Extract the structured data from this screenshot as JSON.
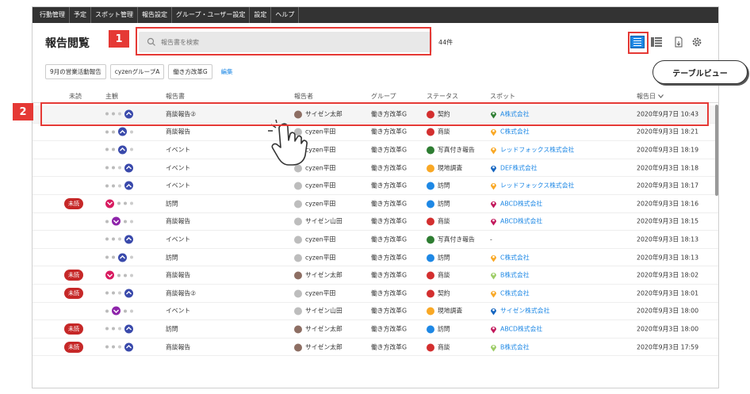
{
  "nav": [
    "行動管理",
    "予定",
    "スポット管理",
    "報告設定",
    "グループ・ユーザー設定",
    "設定",
    "ヘルプ"
  ],
  "header": {
    "title": "報告閲覧",
    "search_placeholder": "報告書を検索",
    "count": "44件"
  },
  "callouts": {
    "one": "1",
    "two": "2",
    "bubble": "テーブルビュー"
  },
  "chips": [
    "9月の営業活動報告",
    "cyzenグループA",
    "働き方改革G"
  ],
  "edit_label": "編集",
  "columns": {
    "unread": "未読",
    "reaction": "主観",
    "report": "報告書",
    "reporter": "報告者",
    "group": "グループ",
    "status": "ステータス",
    "spot": "スポット",
    "date": "報告日"
  },
  "colors": {
    "accent": "#1e88e5",
    "unread": "#c62828",
    "callout": "#e53935"
  },
  "rows": [
    {
      "unread": "",
      "reaction": "blue",
      "report": "商談報告②",
      "reporter": "サイゼン太郎",
      "avatar": "photo",
      "group": "働き方改革G",
      "status": "契約",
      "status_color": "#d32f2f",
      "spot": "A株式会社",
      "spot_icon": "#2e7d32",
      "date": "2020年9月7日 10:43"
    },
    {
      "unread": "",
      "reaction": "blue2",
      "report": "商談報告",
      "reporter": "cyzen平田",
      "avatar": "grey",
      "group": "働き方改革G",
      "status": "商談",
      "status_color": "#d32f2f",
      "spot": "C株式会社",
      "spot_icon": "#f9a825",
      "date": "2020年9月3日 18:21"
    },
    {
      "unread": "",
      "reaction": "blue2",
      "report": "イベント",
      "reporter": "cyzen平田",
      "avatar": "grey",
      "group": "働き方改革G",
      "status": "写真付き報告",
      "status_color": "#2e7d32",
      "spot": "レッドフォックス株式会社",
      "spot_icon": "#f9a825",
      "date": "2020年9月3日 18:19"
    },
    {
      "unread": "",
      "reaction": "blue",
      "report": "イベント",
      "reporter": "cyzen平田",
      "avatar": "grey",
      "group": "働き方改革G",
      "status": "現地調査",
      "status_color": "#f9a825",
      "spot": "DEF株式会社",
      "spot_icon": "#1565c0",
      "date": "2020年9月3日 18:18"
    },
    {
      "unread": "",
      "reaction": "blue",
      "report": "イベント",
      "reporter": "cyzen平田",
      "avatar": "grey",
      "group": "働き方改革G",
      "status": "訪問",
      "status_color": "#1e88e5",
      "spot": "レッドフォックス株式会社",
      "spot_icon": "#f9a825",
      "date": "2020年9月3日 18:17"
    },
    {
      "unread": "未読",
      "reaction": "pink",
      "report": "訪問",
      "reporter": "cyzen平田",
      "avatar": "grey",
      "group": "働き方改革G",
      "status": "訪問",
      "status_color": "#1e88e5",
      "spot": "ABCD株式会社",
      "spot_icon": "#c2185b",
      "date": "2020年9月3日 18:16"
    },
    {
      "unread": "",
      "reaction": "purple",
      "report": "商談報告",
      "reporter": "サイゼン山田",
      "avatar": "grey",
      "group": "働き方改革G",
      "status": "商談",
      "status_color": "#d32f2f",
      "spot": "ABCD株式会社",
      "spot_icon": "#c2185b",
      "date": "2020年9月3日 18:15"
    },
    {
      "unread": "",
      "reaction": "blue",
      "report": "イベント",
      "reporter": "cyzen平田",
      "avatar": "grey",
      "group": "働き方改革G",
      "status": "写真付き報告",
      "status_color": "#2e7d32",
      "spot": "-",
      "spot_icon": "",
      "date": "2020年9月3日 18:13"
    },
    {
      "unread": "",
      "reaction": "blue2",
      "report": "訪問",
      "reporter": "cyzen平田",
      "avatar": "grey",
      "group": "働き方改革G",
      "status": "訪問",
      "status_color": "#1e88e5",
      "spot": "C株式会社",
      "spot_icon": "#f9a825",
      "date": "2020年9月3日 18:13"
    },
    {
      "unread": "未読",
      "reaction": "pink",
      "report": "商談報告",
      "reporter": "サイゼン太郎",
      "avatar": "photo",
      "group": "働き方改革G",
      "status": "商談",
      "status_color": "#d32f2f",
      "spot": "B株式会社",
      "spot_icon": "#9ccc65",
      "date": "2020年9月3日 18:02"
    },
    {
      "unread": "未読",
      "reaction": "blue",
      "report": "商談報告②",
      "reporter": "cyzen平田",
      "avatar": "grey",
      "group": "働き方改革G",
      "status": "契約",
      "status_color": "#d32f2f",
      "spot": "C株式会社",
      "spot_icon": "#f9a825",
      "date": "2020年9月3日 18:01"
    },
    {
      "unread": "",
      "reaction": "purple",
      "report": "イベント",
      "reporter": "サイゼン山田",
      "avatar": "grey",
      "group": "働き方改革G",
      "status": "現地調査",
      "status_color": "#f9a825",
      "spot": "サイゼン株式会社",
      "spot_icon": "#1565c0",
      "date": "2020年9月3日 18:00"
    },
    {
      "unread": "未読",
      "reaction": "blue",
      "report": "訪問",
      "reporter": "サイゼン太郎",
      "avatar": "photo",
      "group": "働き方改革G",
      "status": "訪問",
      "status_color": "#1e88e5",
      "spot": "ABCD株式会社",
      "spot_icon": "#c2185b",
      "date": "2020年9月3日 18:00"
    },
    {
      "unread": "未読",
      "reaction": "blue",
      "report": "商談報告",
      "reporter": "サイゼン太郎",
      "avatar": "photo",
      "group": "働き方改革G",
      "status": "商談",
      "status_color": "#d32f2f",
      "spot": "B株式会社",
      "spot_icon": "#9ccc65",
      "date": "2020年9月3日 17:59"
    }
  ]
}
